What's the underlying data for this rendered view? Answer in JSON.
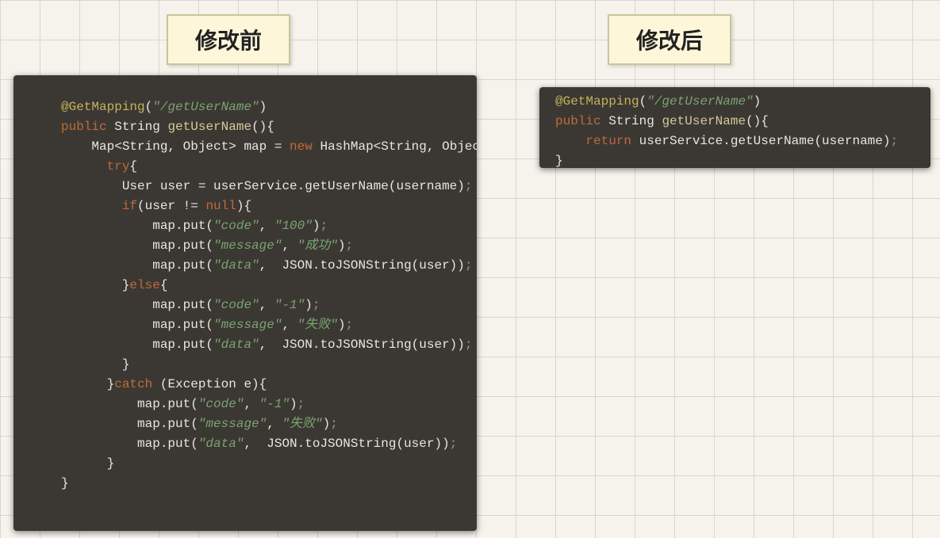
{
  "labels": {
    "before": "修改前",
    "after": "修改后"
  },
  "before": {
    "l1_ann": "@GetMapping",
    "l1_lp": "(",
    "l1_str": "\"/getUserName\"",
    "l1_rp": ")",
    "l2_kw": "public",
    "l2_sp": " ",
    "l2_type": "String",
    "l2_sp2": " ",
    "l2_meth": "getUserName",
    "l2_tail": "(){",
    "l3_pre": "    Map<String, Object> map = ",
    "l3_new": "new",
    "l3_post": " HashMap<String, Object>()",
    "l3_semi": ";",
    "l4_pre": "      ",
    "l4_try": "try",
    "l4_br": "{",
    "l5": "        User user = userService.getUserName(username)",
    "l5_semi": ";",
    "l6_pre": "        ",
    "l6_if": "if",
    "l6_mid": "(user != ",
    "l6_null": "null",
    "l6_tail": "){",
    "l7_pre": "            map.put(",
    "l7_s1": "\"code\"",
    "l7_c": ", ",
    "l7_s2": "\"100\"",
    "l7_rp": ")",
    "l7_semi": ";",
    "l8_pre": "            map.put(",
    "l8_s1": "\"message\"",
    "l8_c": ", ",
    "l8_s2": "\"成功\"",
    "l8_rp": ")",
    "l8_semi": ";",
    "l9_pre": "            map.put(",
    "l9_s1": "\"data\"",
    "l9_c": ",  JSON.toJSONString(user))",
    "l9_semi": ";",
    "l10_pre": "        }",
    "l10_else": "else",
    "l10_br": "{",
    "l11_pre": "            map.put(",
    "l11_s1": "\"code\"",
    "l11_c": ", ",
    "l11_s2": "\"-1\"",
    "l11_rp": ")",
    "l11_semi": ";",
    "l12_pre": "            map.put(",
    "l12_s1": "\"message\"",
    "l12_c": ", ",
    "l12_s2": "\"失败\"",
    "l12_rp": ")",
    "l12_semi": ";",
    "l13_pre": "            map.put(",
    "l13_s1": "\"data\"",
    "l13_c": ",  JSON.toJSONString(user))",
    "l13_semi": ";",
    "l14": "        }",
    "l15_pre": "      }",
    "l15_catch": "catch",
    "l15_tail": " (Exception e){",
    "l16_pre": "          map.put(",
    "l16_s1": "\"code\"",
    "l16_c": ", ",
    "l16_s2": "\"-1\"",
    "l16_rp": ")",
    "l16_semi": ";",
    "l17_pre": "          map.put(",
    "l17_s1": "\"message\"",
    "l17_c": ", ",
    "l17_s2": "\"失败\"",
    "l17_rp": ")",
    "l17_semi": ";",
    "l18_pre": "          map.put(",
    "l18_s1": "\"data\"",
    "l18_c": ",  JSON.toJSONString(user))",
    "l18_semi": ";",
    "l19": "      }",
    "l20": "}"
  },
  "after": {
    "l1_ann": "@GetMapping",
    "l1_lp": "(",
    "l1_str": "\"/getUserName\"",
    "l1_rp": ")",
    "l2_kw": "public",
    "l2_sp": " ",
    "l2_type": "String",
    "l2_sp2": " ",
    "l2_meth": "getUserName",
    "l2_tail": "(){",
    "l3_pre": "    ",
    "l3_ret": "return",
    "l3_post": " userService.getUserName(username)",
    "l3_semi": ";",
    "l4": "}"
  }
}
